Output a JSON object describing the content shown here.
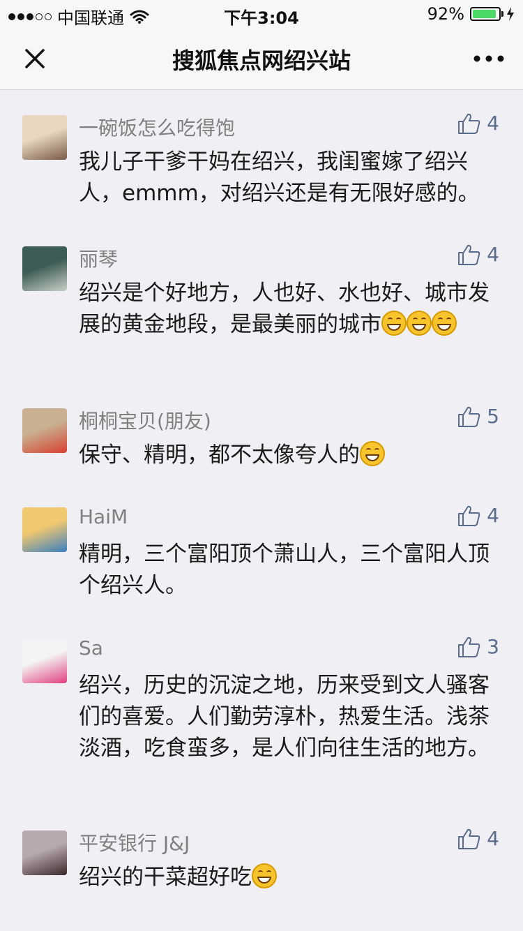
{
  "status": {
    "carrier": "中国联通",
    "time": "下午3:04",
    "battery": "92%",
    "battery_level": 0.92,
    "signal_filled": 3
  },
  "nav": {
    "title": "搜狐焦点网绍兴站"
  },
  "comments": [
    {
      "name": "一碗饭怎么吃得饱",
      "likes": "4",
      "text": "我儿子干爹干妈在绍兴，我闺蜜嫁了绍兴人，emmm，对绍兴还是有无限好感的。",
      "emojis": 0,
      "avatar_colors": [
        "#e8d8c0",
        "#7a5b48"
      ]
    },
    {
      "name": "丽琴",
      "likes": "4",
      "text": "绍兴是个好地方，人也好、水也好、城市发展的黄金地段，是最美丽的城市",
      "emojis": 3,
      "avatar_colors": [
        "#3d5c55",
        "#c8d0c8"
      ]
    },
    {
      "name": "桐桐宝贝(朋友)",
      "likes": "5",
      "text": "保守、精明，都不太像夸人的",
      "emojis": 1,
      "avatar_colors": [
        "#c8b090",
        "#d84030"
      ]
    },
    {
      "name": "HaiM",
      "likes": "4",
      "text": "精明，三个富阳顶个萧山人，三个富阳人顶个绍兴人。",
      "emojis": 0,
      "avatar_colors": [
        "#f0c870",
        "#3a7fbf"
      ]
    },
    {
      "name": "Sa",
      "likes": "3",
      "text": "绍兴，历史的沉淀之地，历来受到文人骚客们的喜爱。人们勤劳淳朴，热爱生活。浅茶淡酒，吃食蛮多，是人们向往生活的地方。",
      "emojis": 0,
      "avatar_colors": [
        "#f4f4f4",
        "#e04080"
      ]
    },
    {
      "name": "平安银行 J&J",
      "likes": "4",
      "text": "绍兴的干菜超好吃",
      "emojis": 1,
      "avatar_colors": [
        "#b8a8b0",
        "#3a2a2a"
      ]
    }
  ]
}
